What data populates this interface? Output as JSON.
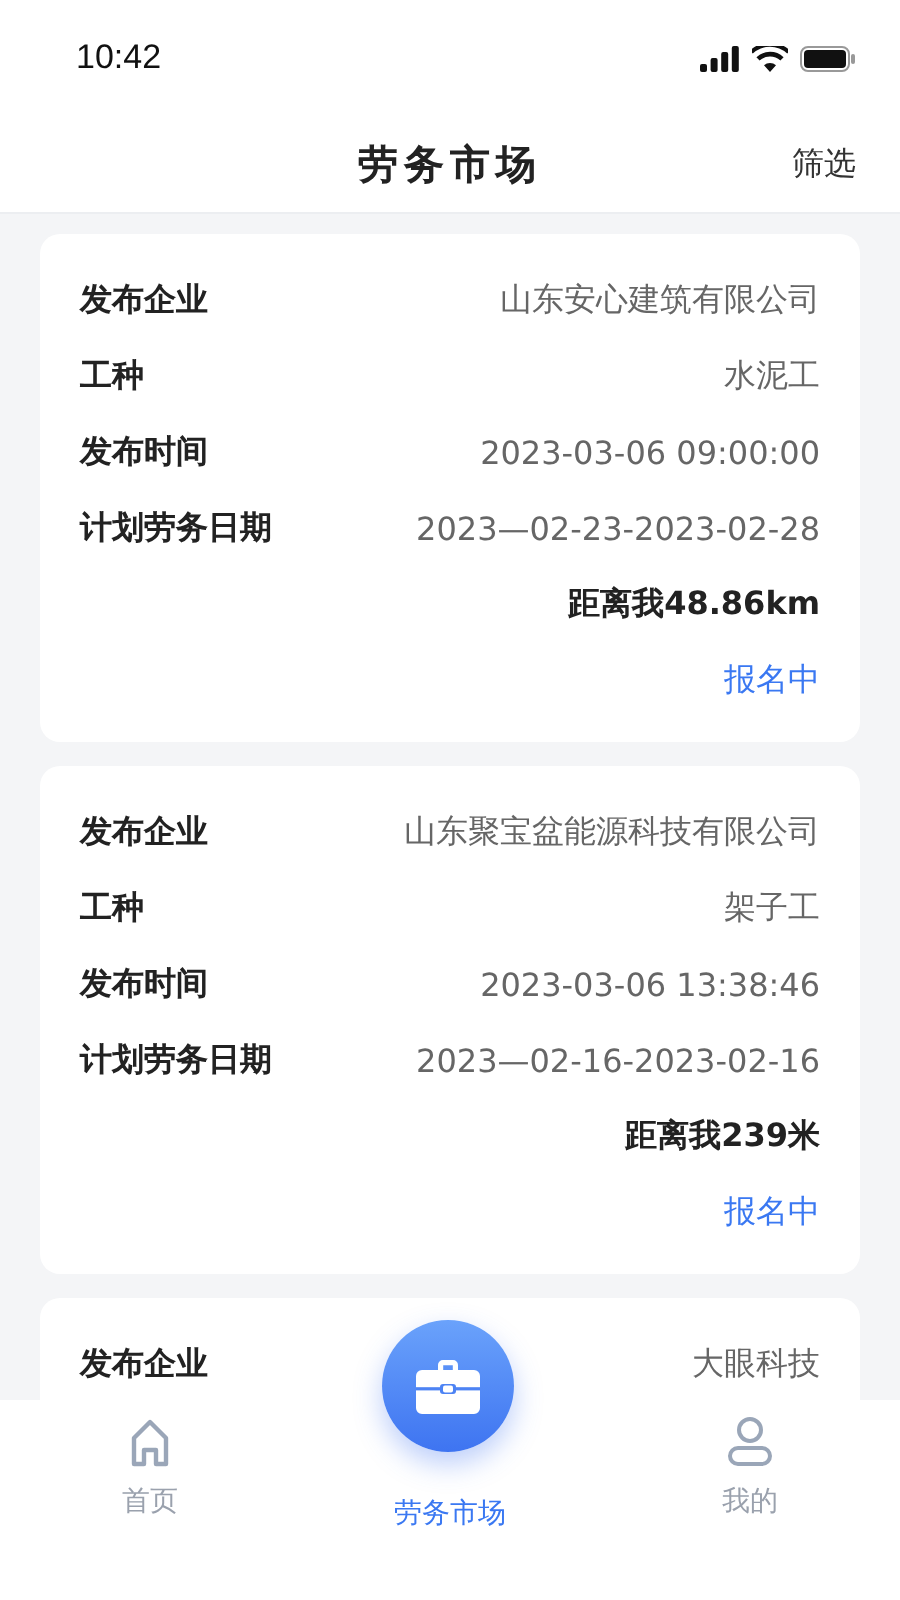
{
  "status_bar": {
    "time": "10:42"
  },
  "header": {
    "title": "劳务市场",
    "action": "筛选"
  },
  "cards": [
    {
      "rows": [
        {
          "label": "发布企业",
          "value": "山东安心建筑有限公司"
        },
        {
          "label": "工种",
          "value": "水泥工"
        },
        {
          "label": "发布时间",
          "value": "2023-03-06 09:00:00"
        },
        {
          "label": "计划劳务日期",
          "value": "2023—02-23-2023-02-28"
        }
      ],
      "distance": "距离我48.86km",
      "status": "报名中"
    },
    {
      "rows": [
        {
          "label": "发布企业",
          "value": "山东聚宝盆能源科技有限公司"
        },
        {
          "label": "工种",
          "value": "架子工"
        },
        {
          "label": "发布时间",
          "value": "2023-03-06 13:38:46"
        },
        {
          "label": "计划劳务日期",
          "value": "2023—02-16-2023-02-16"
        }
      ],
      "distance": "距离我239米",
      "status": "报名中"
    },
    {
      "rows": [
        {
          "label": "发布企业",
          "value": "大眼科技"
        }
      ]
    }
  ],
  "tab_bar": [
    {
      "label": "首页",
      "kind": "home",
      "selected": false
    },
    {
      "label": "劳务市场",
      "kind": "market",
      "selected": true
    },
    {
      "label": "我的",
      "kind": "profile",
      "selected": false
    }
  ]
}
